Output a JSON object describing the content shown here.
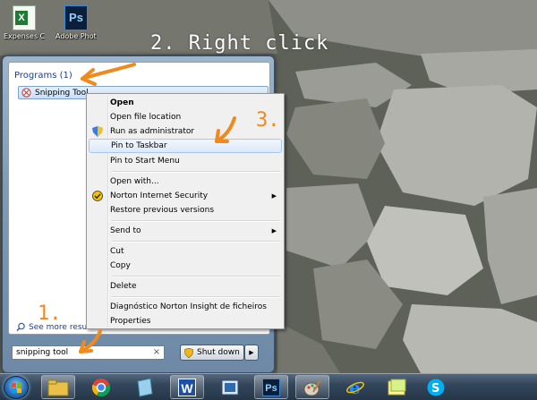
{
  "desktop": {
    "icons": [
      {
        "label": "Expenses Calculate",
        "icon": "excel-file-icon"
      },
      {
        "label": "Adobe Photosho",
        "icon": "photoshop-icon",
        "glyph": "Ps"
      }
    ]
  },
  "annotations": {
    "step2": "2. Right click",
    "step3": "3.",
    "step1": "1."
  },
  "start_menu": {
    "programs_header": "Programs (1)",
    "program_item": "Snipping Tool",
    "see_more": "See more results",
    "search_value": "snipping tool",
    "search_clear": "×",
    "shutdown_label": "Shut down",
    "shutdown_arrow": "▶"
  },
  "context_menu": {
    "items": [
      {
        "label": "Open"
      },
      {
        "label": "Open file location"
      },
      {
        "label": "Run as administrator"
      },
      {
        "label": "Pin to Taskbar"
      },
      {
        "label": "Pin to Start Menu"
      },
      {
        "label": "Open with..."
      },
      {
        "label": "Norton Internet Security"
      },
      {
        "label": "Restore previous versions"
      },
      {
        "label": "Send to"
      },
      {
        "label": "Cut"
      },
      {
        "label": "Copy"
      },
      {
        "label": "Delete"
      },
      {
        "label": "Diagnóstico Norton Insight de ficheiros"
      },
      {
        "label": "Properties"
      }
    ],
    "submenu_arrow": "▶"
  },
  "taskbar": {
    "pinned": [
      "file-explorer-icon",
      "chrome-icon",
      "notepad-icon",
      "word-icon",
      "media-icon",
      "photoshop-icon",
      "paint-icon",
      "internet-explorer-icon",
      "sticky-notes-icon",
      "skype-icon"
    ],
    "photoshop_glyph": "Ps",
    "word_glyph": "W"
  },
  "colors": {
    "annotation_orange": "#f08a1c",
    "menu_link_blue": "#1c3f94",
    "highlight_border": "#a8c7ee"
  }
}
